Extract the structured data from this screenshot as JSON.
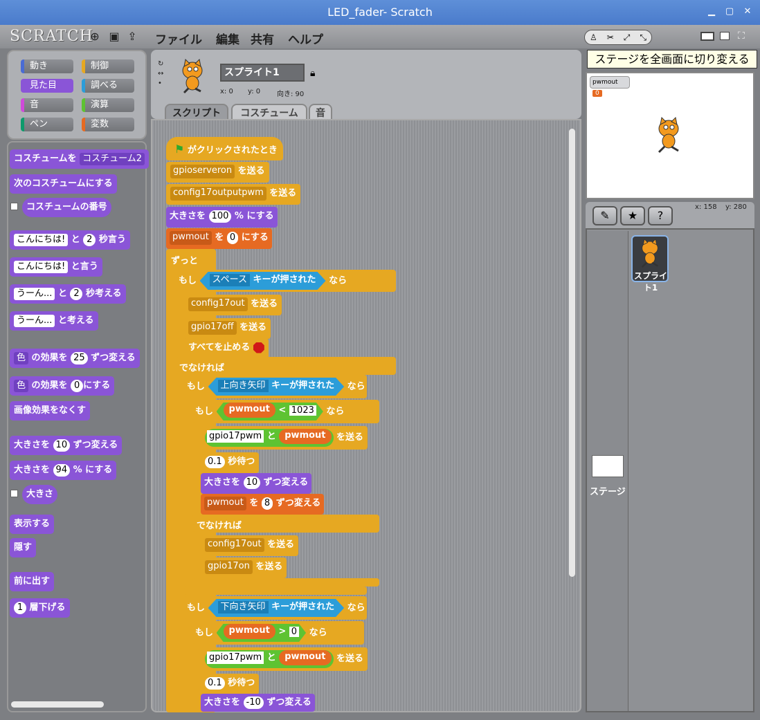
{
  "window": {
    "title": "LED_fader- Scratch",
    "min": "▁",
    "max": "▢",
    "close": "✕"
  },
  "menu": {
    "logo": "SCRATCH",
    "file": "ファイル",
    "edit": "編集",
    "share": "共有",
    "help": "ヘルプ"
  },
  "tooltip": "ステージを全画面に切り変える",
  "categories": [
    "動き",
    "制御",
    "見た目",
    "調べる",
    "音",
    "演算",
    "ペン",
    "変数"
  ],
  "category_colors": [
    "#4a6cd4",
    "#e6a822",
    "#8a55d7",
    "#2c9dd9",
    "#cf4ad9",
    "#5ec332",
    "#0e9a6c",
    "#e66a22"
  ],
  "palette": {
    "costume_to": "コスチュームを",
    "costume_to_val": "コスチューム2",
    "next_costume": "次のコスチュームにする",
    "costume_num": "コスチュームの番号",
    "say_for_a": "こんにちは!",
    "say_for_b": "と",
    "say_for_n": "2",
    "say_for_c": "秒言う",
    "say_a": "こんにちは!",
    "say_b": "と言う",
    "think_for_a": "うーん...",
    "think_for_b": "と",
    "think_for_n": "2",
    "think_for_c": "秒考える",
    "think_a": "うーん...",
    "think_b": "と考える",
    "effect_change_a": "色",
    "effect_change_b": "の効果を",
    "effect_change_n": "25",
    "effect_change_c": "ずつ変える",
    "effect_set_a": "色",
    "effect_set_b": "の効果を",
    "effect_set_n": "0",
    "effect_set_c": "にする",
    "clear_effects": "画像効果をなくす",
    "size_change_a": "大きさを",
    "size_change_n": "10",
    "size_change_b": "ずつ変える",
    "size_set_a": "大きさを",
    "size_set_n": "94",
    "size_set_b": "% にする",
    "size": "大きさ",
    "show": "表示する",
    "hide": "隠す",
    "front": "前に出す",
    "back_n": "1",
    "back_b": "層下げる"
  },
  "sprite": {
    "name": "スプライト1",
    "x": "x: 0",
    "y": "y: 0",
    "dir": "向き: 90"
  },
  "tabs": {
    "scripts": "スクリプト",
    "costumes": "コスチューム",
    "sound": "音"
  },
  "script": {
    "hat": "がクリックされたとき",
    "b1_d": "gpioserveron",
    "send": "を送る",
    "b2_d": "config17outputpwm",
    "b3_a": "大きさを",
    "b3_n": "100",
    "b3_b": "% にする",
    "b4_d": "pwmout",
    "b4_a": "を",
    "b4_n": "0",
    "b4_b": "にする",
    "forever": "ずっと",
    "if": "もし",
    "then": "なら",
    "else": "でなければ",
    "key_space": "スペース",
    "key_pressed": "キーが押された",
    "c1_d": "config17out",
    "c2_d": "gpio17off",
    "stop_all": "すべてを止める",
    "key_up": "上向き矢印",
    "key_down": "下向き矢印",
    "var": "pwmout",
    "lt": "<",
    "gt": ">",
    "v1023": "1023",
    "v0": "0",
    "join_a": "gpio17pwm",
    "join_b": "と",
    "wait_n": "0.1",
    "wait": "秒待つ",
    "sz_a": "大きさを",
    "sz_n": "10",
    "sz_b": "ずつ変える",
    "pw_a": "を",
    "pw_n": "8",
    "pw_b": "ずつ変える",
    "e1_d": "config17out",
    "e2_d": "gpio17on",
    "sz2_n": "-10"
  },
  "stage": {
    "monitor_name": "pwmout",
    "monitor_val": "0",
    "xpos": "x: 158",
    "ypos": "y: 280"
  },
  "sprites": {
    "sprite1": "スプライト1",
    "stage": "ステージ"
  }
}
